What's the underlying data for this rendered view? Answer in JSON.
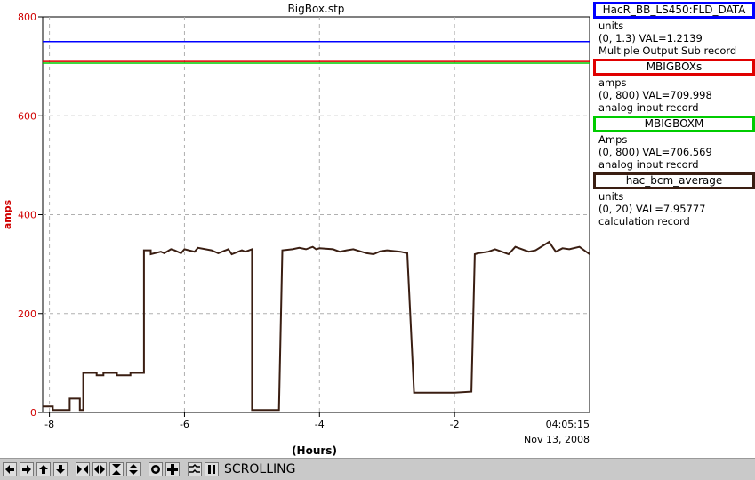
{
  "chart_data": {
    "type": "line",
    "title": "BigBox.stp",
    "xlabel": "(Hours)",
    "ylabel": "amps",
    "xlim": [
      -8.1,
      -0.0
    ],
    "ylim": [
      0,
      800
    ],
    "x_ticks": [
      -8,
      -6,
      -4,
      -2
    ],
    "y_ticks": [
      0,
      200,
      400,
      600,
      800
    ],
    "x_tick_labels": [
      "-8",
      "-6",
      "-4",
      "-2"
    ],
    "y_tick_labels": [
      "0",
      "200",
      "400",
      "600",
      "800"
    ],
    "time_label": "04:05:15",
    "date_label": "Nov 13, 2008",
    "grid": true,
    "series": [
      {
        "name": "HacR_BB_LS450:FLD_DATA",
        "color": "#0000ff",
        "x": [
          -8.1,
          0.0
        ],
        "y": [
          750,
          750
        ]
      },
      {
        "name": "MBIGBOXs",
        "color": "#e00000",
        "x": [
          -8.1,
          0.0
        ],
        "y": [
          710,
          710
        ]
      },
      {
        "name": "MBIGBOXM",
        "color": "#00cc00",
        "x": [
          -8.1,
          0.0
        ],
        "y": [
          706.6,
          706.6
        ]
      },
      {
        "name": "hac_bcm_average",
        "color": "#3a1e12",
        "x": [
          -8.1,
          -7.95,
          -7.95,
          -7.7,
          -7.7,
          -7.55,
          -7.55,
          -7.5,
          -7.5,
          -7.3,
          -7.3,
          -7.2,
          -7.2,
          -7.0,
          -7.0,
          -6.8,
          -6.8,
          -6.6,
          -6.6,
          -6.5,
          -6.5,
          -6.35,
          -6.3,
          -6.2,
          -6.15,
          -6.05,
          -6.0,
          -5.85,
          -5.8,
          -5.6,
          -5.5,
          -5.35,
          -5.3,
          -5.15,
          -5.1,
          -5.0,
          -5.0,
          -4.6,
          -4.55,
          -4.4,
          -4.3,
          -4.2,
          -4.1,
          -4.05,
          -4.0,
          -3.8,
          -3.7,
          -3.6,
          -3.5,
          -3.3,
          -3.2,
          -3.1,
          -3.0,
          -2.8,
          -2.7,
          -2.6,
          -2.2,
          -2.0,
          -1.75,
          -1.7,
          -1.65,
          -1.5,
          -1.4,
          -1.2,
          -1.1,
          -0.9,
          -0.8,
          -0.6,
          -0.5,
          -0.4,
          -0.3,
          -0.15,
          0.0
        ],
        "y": [
          12,
          12,
          5,
          5,
          28,
          28,
          5,
          5,
          80,
          80,
          75,
          75,
          80,
          80,
          75,
          75,
          80,
          80,
          328,
          328,
          320,
          325,
          322,
          330,
          328,
          322,
          330,
          325,
          333,
          328,
          322,
          330,
          320,
          328,
          325,
          330,
          5,
          5,
          328,
          330,
          333,
          330,
          335,
          330,
          332,
          330,
          325,
          328,
          330,
          322,
          320,
          326,
          328,
          325,
          322,
          40,
          40,
          40,
          42,
          320,
          322,
          325,
          330,
          320,
          335,
          325,
          328,
          345,
          325,
          332,
          330,
          335,
          320
        ]
      }
    ]
  },
  "legend": [
    {
      "name": "HacR_BB_LS450:FLD_DATA",
      "color": "#0000ff",
      "units": "units",
      "range_val": "(0, 1.3) VAL=1.2139",
      "record": "Multiple Output Sub record"
    },
    {
      "name": "MBIGBOXs",
      "color": "#e00000",
      "units": "amps",
      "range_val": "(0, 800) VAL=709.998",
      "record": "analog input record"
    },
    {
      "name": "MBIGBOXM",
      "color": "#00cc00",
      "units": "Amps",
      "range_val": "(0, 800) VAL=706.569",
      "record": "analog input record"
    },
    {
      "name": "hac_bcm_average",
      "color": "#3a1e12",
      "units": "units",
      "range_val": "(0, 20) VAL=7.95777",
      "record": "calculation record"
    }
  ],
  "toolbar": {
    "buttons": [
      "arrow-left-icon",
      "arrow-right-icon",
      "arrow-up-icon",
      "arrow-down-icon",
      "shrink-horizontal-icon",
      "expand-horizontal-icon",
      "shrink-vertical-icon",
      "expand-vertical-icon",
      "record-icon",
      "plus-icon",
      "waveform-icon",
      "pause-icon"
    ],
    "status": "SCROLLING"
  }
}
